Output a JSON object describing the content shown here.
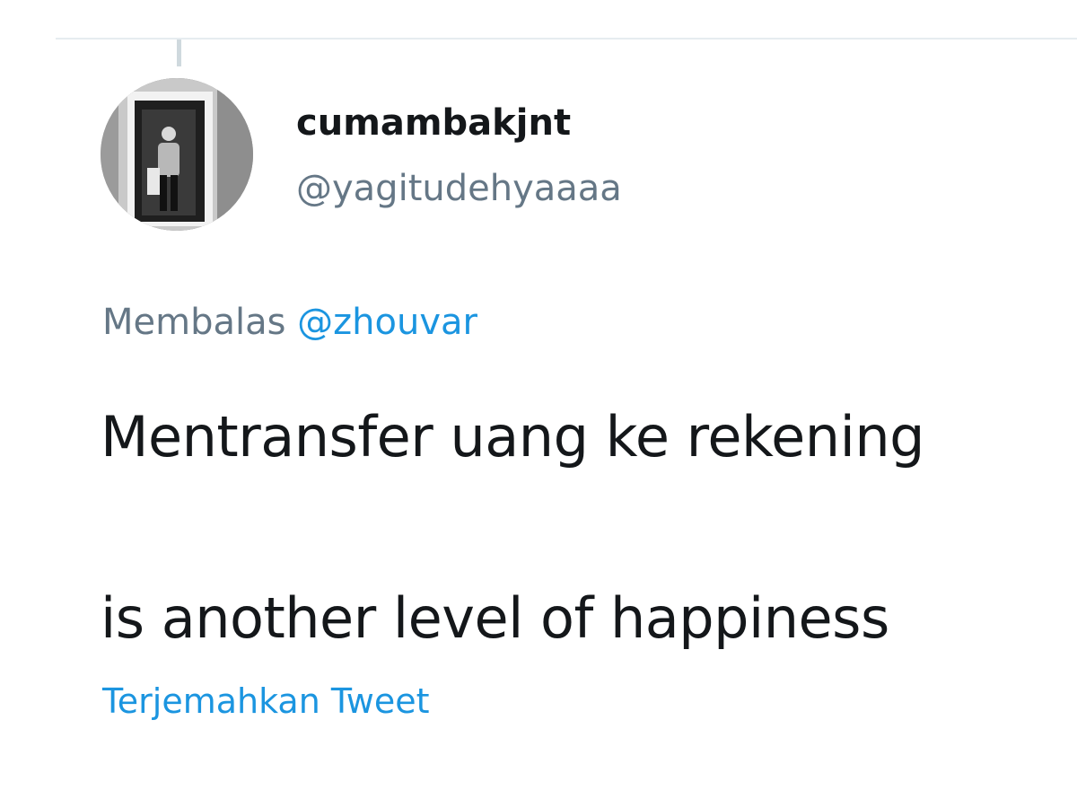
{
  "tweet": {
    "author": {
      "display_name": "cumambakjnt",
      "handle": "@yagitudehyaaaa",
      "avatar_icon": "user-photo-avatar"
    },
    "reply": {
      "prefix": "Membalas",
      "mention": "@zhouvar"
    },
    "text_line1": "Mentransfer uang ke rekening",
    "text_line2": "is another level of happiness",
    "translate_label": "Terjemahkan Tweet"
  },
  "colors": {
    "text_primary": "#14171a",
    "text_secondary": "#657786",
    "link": "#1b95e0",
    "divider": "#e6ecf0"
  }
}
